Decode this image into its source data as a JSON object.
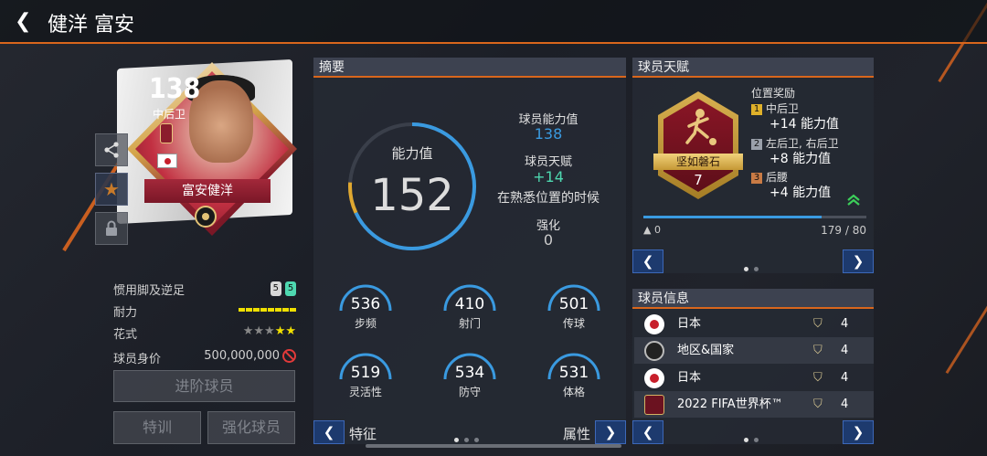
{
  "header": {
    "title": "健洋 富安"
  },
  "card": {
    "overall": "138",
    "position": "中后卫",
    "name": "富安健洋"
  },
  "player_info": [
    {
      "label": "惯用脚及逆足",
      "left_foot": "5",
      "right_foot": "5"
    },
    {
      "label": "耐力",
      "bars": 8
    },
    {
      "label": "花式",
      "stars_on": 2,
      "stars_total": 5
    },
    {
      "label": "球员身价",
      "value": "500,000,000"
    }
  ],
  "buttons": {
    "promote": "进阶球员",
    "train": "特训",
    "enhance": "强化球员"
  },
  "summary": {
    "title": "摘要",
    "ability_label": "能力值",
    "ability_value": "152",
    "ability_fraction": 0.76,
    "player_ability_label": "球员能力值",
    "player_ability_value": "138",
    "talent_label": "球员天赋",
    "talent_value": "+14",
    "talent_note": "在熟悉位置的时候",
    "enhance_label": "强化",
    "enhance_value": "0",
    "stats": [
      {
        "value": "536",
        "label": "步频"
      },
      {
        "value": "410",
        "label": "射门"
      },
      {
        "value": "501",
        "label": "传球"
      },
      {
        "value": "519",
        "label": "灵活性"
      },
      {
        "value": "534",
        "label": "防守"
      },
      {
        "value": "531",
        "label": "体格"
      }
    ],
    "footer_left": "特征",
    "footer_right": "属性"
  },
  "talent": {
    "title": "球员天赋",
    "badge_name": "坚如磐石",
    "badge_level": "7",
    "position_bonus_title": "位置奖励",
    "bonuses": [
      {
        "rank": "1",
        "position": "中后卫",
        "value": "+14 能力值",
        "color": "#e0b12a"
      },
      {
        "rank": "2",
        "position": "左后卫, 右后卫",
        "value": "+8 能力值",
        "color": "#9aa0aa"
      },
      {
        "rank": "3",
        "position": "后腰",
        "value": "+4 能力值",
        "color": "#c97b45"
      }
    ],
    "progress_left": "0",
    "progress_right": "179 / 80",
    "progress_fraction": 0.8
  },
  "player_details": {
    "title": "球员信息",
    "rows": [
      {
        "icon": "japan-flag-icon",
        "text": "日本",
        "count": "4"
      },
      {
        "icon": "world-icon",
        "text": "地区&国家",
        "count": "4"
      },
      {
        "icon": "japan-flag-icon",
        "text": "日本",
        "count": "4"
      },
      {
        "icon": "world-cup-icon",
        "text": "2022 FIFA世界杯™",
        "count": "4"
      }
    ]
  },
  "colors": {
    "accent": "#d9661c",
    "ring": "#3a9ae0",
    "talent_green": "#4ed8b0",
    "nav_blue": "#1d3a6e"
  }
}
